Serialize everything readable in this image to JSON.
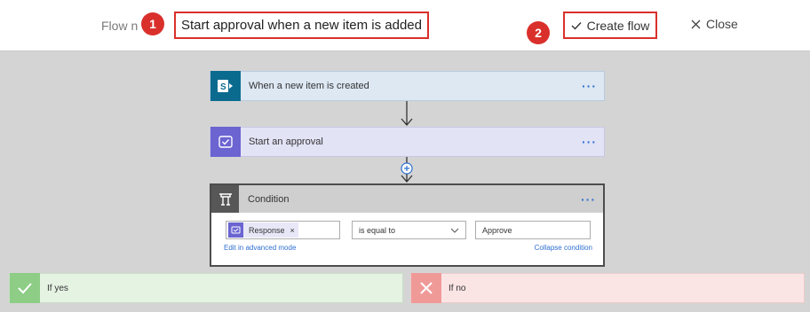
{
  "header": {
    "flow_name_label": "Flow n",
    "flow_name_value": "Start approval when a new item is added",
    "create_flow_label": "Create flow",
    "close_label": "Close",
    "markers": [
      "1",
      "2"
    ],
    "accent_color": "#d9302b"
  },
  "steps": {
    "trigger": {
      "label": "When a new item is created",
      "icon": "sharepoint-icon",
      "more": "···"
    },
    "approval": {
      "label": "Start an approval",
      "icon": "approval-icon",
      "more": "···"
    }
  },
  "condition": {
    "title": "Condition",
    "icon": "condition-icon",
    "more": "···",
    "left_token": "Response",
    "left_token_remove": "×",
    "operator": "is equal to",
    "value": "Approve",
    "edit_advanced_label": "Edit in advanced mode",
    "collapse_label": "Collapse condition"
  },
  "branches": {
    "yes_label": "If yes",
    "no_label": "If no"
  }
}
